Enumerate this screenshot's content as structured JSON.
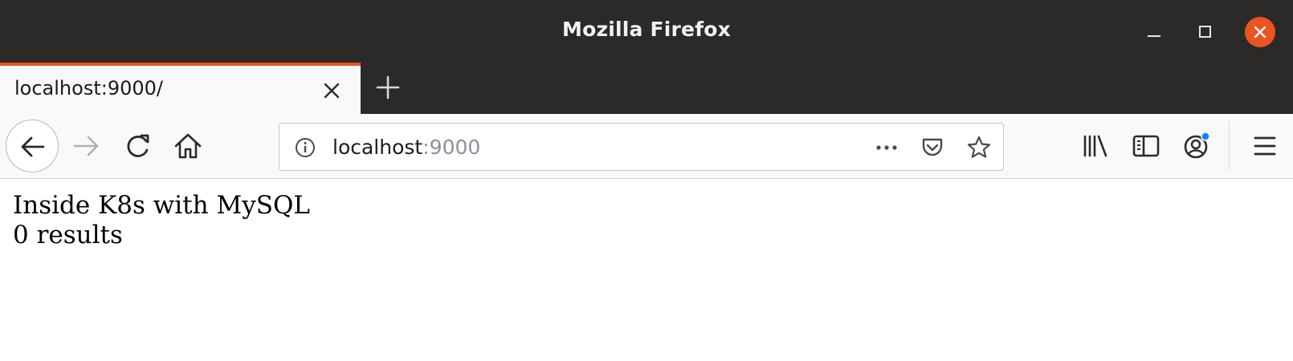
{
  "window": {
    "title": "Mozilla Firefox",
    "controls": [
      "minimize-icon",
      "maximize-icon",
      "close-icon"
    ],
    "accent_color": "#e9541f"
  },
  "tabs": [
    {
      "label": "localhost:9000/",
      "active": true
    }
  ],
  "toolbar": {
    "url_host": "localhost",
    "url_port": ":9000",
    "icons": [
      "back-arrow-icon",
      "forward-arrow-icon",
      "reload-icon",
      "home-icon",
      "info-icon",
      "more-dots-icon",
      "pocket-icon",
      "star-icon",
      "library-icon",
      "sidebar-icon",
      "account-icon",
      "hamburger-menu-icon"
    ]
  },
  "page": {
    "heading_line": "Inside K8s with MySQL",
    "results_line": "0 results"
  }
}
